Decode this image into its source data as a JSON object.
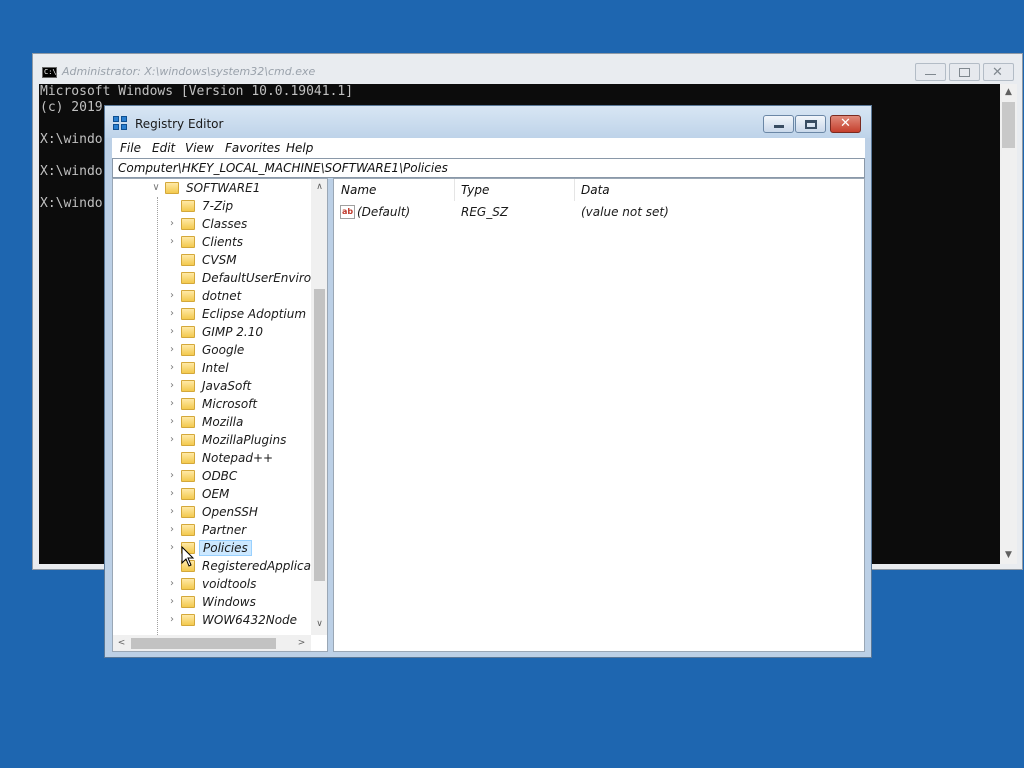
{
  "cmd": {
    "title": "Administrator: X:\\windows\\system32\\cmd.exe",
    "icon_text": "C:\\.",
    "lines": [
      "Microsoft Windows [Version 10.0.19041.1]",
      "(c) 2019",
      "",
      "X:\\windo",
      "",
      "X:\\windo",
      "",
      "X:\\windo"
    ]
  },
  "regedit": {
    "title": "Registry Editor",
    "menu": [
      "File",
      "Edit",
      "View",
      "Favorites",
      "Help"
    ],
    "address": "Computer\\HKEY_LOCAL_MACHINE\\SOFTWARE1\\Policies",
    "tree": {
      "root": {
        "label": "SOFTWARE1",
        "expander": "∨"
      },
      "children": [
        {
          "label": "7-Zip",
          "has_children": false
        },
        {
          "label": "Classes",
          "has_children": true
        },
        {
          "label": "Clients",
          "has_children": true
        },
        {
          "label": "CVSM",
          "has_children": false
        },
        {
          "label": "DefaultUserEnvironm",
          "has_children": false
        },
        {
          "label": "dotnet",
          "has_children": true
        },
        {
          "label": "Eclipse Adoptium",
          "has_children": true
        },
        {
          "label": "GIMP 2.10",
          "has_children": true
        },
        {
          "label": "Google",
          "has_children": true
        },
        {
          "label": "Intel",
          "has_children": true
        },
        {
          "label": "JavaSoft",
          "has_children": true
        },
        {
          "label": "Microsoft",
          "has_children": true
        },
        {
          "label": "Mozilla",
          "has_children": true
        },
        {
          "label": "MozillaPlugins",
          "has_children": true
        },
        {
          "label": "Notepad++",
          "has_children": false
        },
        {
          "label": "ODBC",
          "has_children": true
        },
        {
          "label": "OEM",
          "has_children": true
        },
        {
          "label": "OpenSSH",
          "has_children": true
        },
        {
          "label": "Partner",
          "has_children": true
        },
        {
          "label": "Policies",
          "has_children": true,
          "selected": true
        },
        {
          "label": "RegisteredApplicatic",
          "has_children": false
        },
        {
          "label": "voidtools",
          "has_children": true
        },
        {
          "label": "Windows",
          "has_children": true
        },
        {
          "label": "WOW6432Node",
          "has_children": true
        }
      ]
    },
    "list": {
      "columns": [
        "Name",
        "Type",
        "Data"
      ],
      "rows": [
        {
          "name": "(Default)",
          "type": "REG_SZ",
          "data": "(value not set)",
          "icon": "ab"
        }
      ]
    }
  }
}
